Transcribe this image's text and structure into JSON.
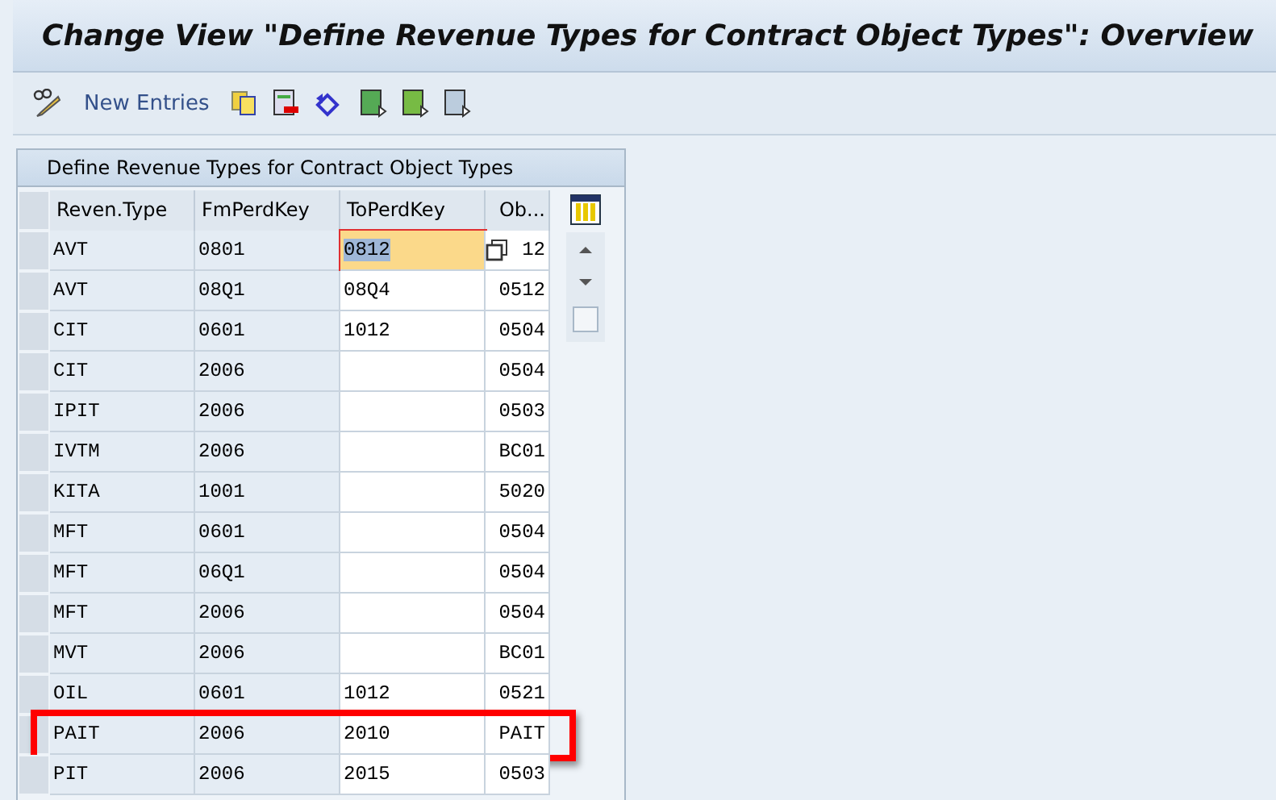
{
  "window": {
    "title": "Change View \"Define Revenue Types for Contract Object Types\": Overview"
  },
  "toolbar": {
    "new_entries": "New Entries"
  },
  "table": {
    "title": "Define Revenue Types for Contract Object Types",
    "columns": [
      "Reven.Type",
      "FmPerdKey",
      "ToPerdKey",
      "Ob..."
    ],
    "rows": [
      {
        "type": "AVT",
        "from": "0801",
        "to": "0812",
        "obj": "12",
        "to_focused": true,
        "marked": false
      },
      {
        "type": "AVT",
        "from": "08Q1",
        "to": "08Q4",
        "obj": "0512",
        "to_focused": false,
        "marked": false
      },
      {
        "type": "CIT",
        "from": "0601",
        "to": "1012",
        "obj": "0504",
        "to_focused": false,
        "marked": false
      },
      {
        "type": "CIT",
        "from": "2006",
        "to": "",
        "obj": "0504",
        "to_focused": false,
        "marked": false
      },
      {
        "type": "IPIT",
        "from": "2006",
        "to": "",
        "obj": "0503",
        "to_focused": false,
        "marked": false
      },
      {
        "type": "IVTM",
        "from": "2006",
        "to": "",
        "obj": "BC01",
        "to_focused": false,
        "marked": false
      },
      {
        "type": "KITA",
        "from": "1001",
        "to": "",
        "obj": "5020",
        "to_focused": false,
        "marked": false
      },
      {
        "type": "MFT",
        "from": "0601",
        "to": "",
        "obj": "0504",
        "to_focused": false,
        "marked": false
      },
      {
        "type": "MFT",
        "from": "06Q1",
        "to": "",
        "obj": "0504",
        "to_focused": false,
        "marked": false
      },
      {
        "type": "MFT",
        "from": "2006",
        "to": "",
        "obj": "0504",
        "to_focused": false,
        "marked": false
      },
      {
        "type": "MVT",
        "from": "2006",
        "to": "",
        "obj": "BC01",
        "to_focused": false,
        "marked": false
      },
      {
        "type": "OIL",
        "from": "0601",
        "to": "1012",
        "obj": "0521",
        "to_focused": false,
        "marked": false
      },
      {
        "type": "PAIT",
        "from": "2006",
        "to": "2010",
        "obj": "PAIT",
        "to_focused": false,
        "marked": true
      },
      {
        "type": "PIT",
        "from": "2006",
        "to": "2015",
        "obj": "0503",
        "to_focused": false,
        "marked": false
      }
    ]
  }
}
